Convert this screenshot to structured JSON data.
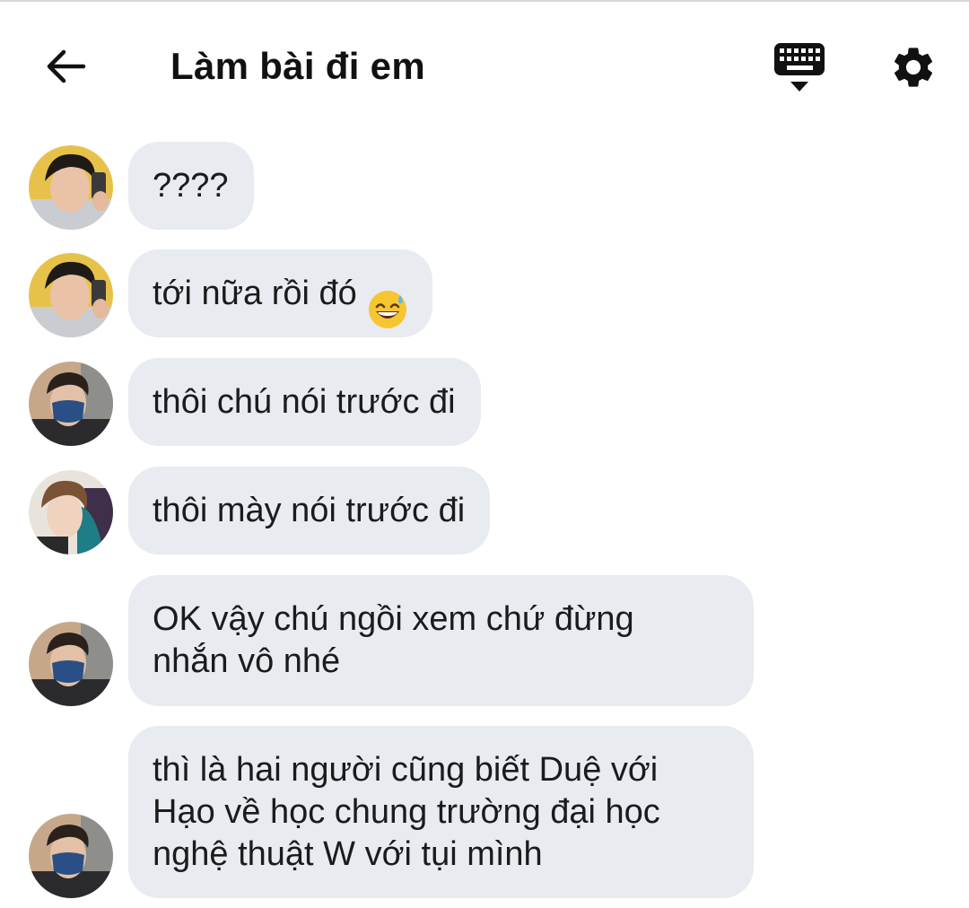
{
  "header": {
    "title": "Làm bài đi em",
    "back_icon": "arrow-left-icon",
    "keyboard_icon": "keyboard-icon",
    "settings_icon": "gear-icon"
  },
  "messages": [
    {
      "avatar": "avatar-a",
      "text": "????"
    },
    {
      "avatar": "avatar-a",
      "text": "tới nữa rồi đó",
      "emoji": "grinning-sweat-emoji"
    },
    {
      "avatar": "avatar-b",
      "text": "thôi chú nói trước đi"
    },
    {
      "avatar": "avatar-c",
      "text": "thôi mày nói trước đi"
    },
    {
      "avatar": "avatar-b",
      "text": "OK vậy chú ngồi xem chứ đừng\nnhắn vô nhé"
    },
    {
      "avatar": "avatar-b",
      "text": "thì là hai người cũng biết Duệ với\nHạo về học chung trường đại học\nnghệ thuật W với tụi mình"
    }
  ],
  "colors": {
    "bubble": "#e8ebf0",
    "text": "#1b1b1b",
    "icon": "#111111"
  }
}
